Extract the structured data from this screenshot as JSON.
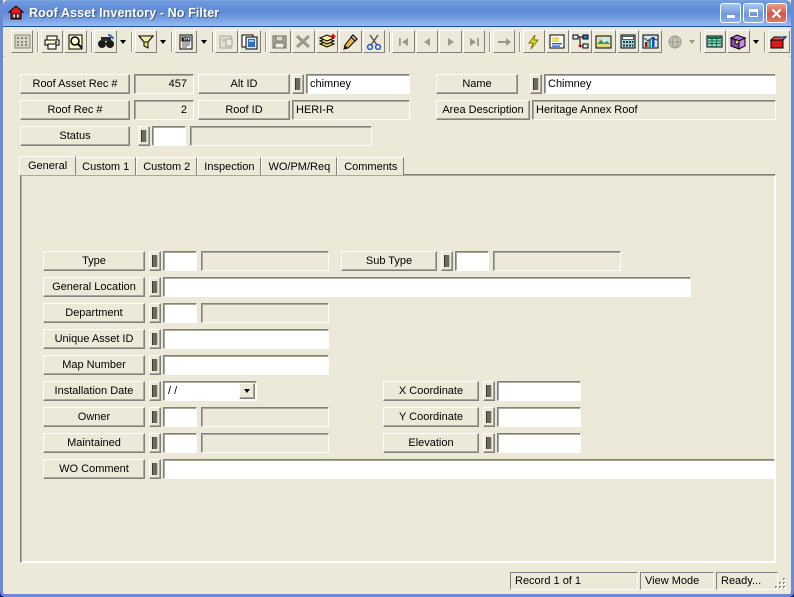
{
  "window": {
    "title": "Roof Asset Inventory - No Filter",
    "icon": "house-icon",
    "minimize_label": "Minimize",
    "maximize_label": "Maximize",
    "close_label": "Close",
    "accent_title_color": "#6d97dc",
    "face_color": "#ece9d8"
  },
  "toolbar": {
    "buttons": [
      {
        "name": "grid-view-icon",
        "label": "Grid View",
        "enabled": false
      },
      {
        "name": "print-icon",
        "label": "Print",
        "enabled": true
      },
      {
        "name": "print-preview-icon",
        "label": "Print Preview",
        "enabled": true
      },
      {
        "name": "find-icon",
        "label": "Find",
        "enabled": true
      },
      {
        "name": "filter-icon",
        "label": "Filter",
        "enabled": true
      },
      {
        "name": "report-icon",
        "label": "Report",
        "enabled": true
      },
      {
        "name": "copy-to-icon",
        "label": "Copy To",
        "enabled": false
      },
      {
        "name": "duplicate-record-icon",
        "label": "Duplicate Record",
        "enabled": true
      },
      {
        "name": "save-icon",
        "label": "Save",
        "enabled": false
      },
      {
        "name": "delete-record-icon",
        "label": "Delete Record",
        "enabled": false
      },
      {
        "name": "add-record-icon",
        "label": "Add Record",
        "enabled": true
      },
      {
        "name": "edit-record-icon",
        "label": "Edit Record",
        "enabled": true
      },
      {
        "name": "cut-icon",
        "label": "Cut",
        "enabled": true
      },
      {
        "name": "first-record-icon",
        "label": "First Record",
        "enabled": false
      },
      {
        "name": "previous-record-icon",
        "label": "Previous Record",
        "enabled": false
      },
      {
        "name": "next-record-icon",
        "label": "Next Record",
        "enabled": false
      },
      {
        "name": "last-record-icon",
        "label": "Last Record",
        "enabled": false
      },
      {
        "name": "goto-record-icon",
        "label": "Go To Record",
        "enabled": false
      },
      {
        "name": "action-icon",
        "label": "Action",
        "enabled": true
      },
      {
        "name": "notes-icon",
        "label": "Notes",
        "enabled": true
      },
      {
        "name": "links-icon",
        "label": "Links",
        "enabled": true
      },
      {
        "name": "image-icon",
        "label": "Image",
        "enabled": true
      },
      {
        "name": "calculator-icon",
        "label": "Calculator",
        "enabled": true
      },
      {
        "name": "chart-icon",
        "label": "Chart",
        "enabled": true
      },
      {
        "name": "globe-icon",
        "label": "Web",
        "enabled": false
      },
      {
        "name": "spreadsheet-icon",
        "label": "Spreadsheet",
        "enabled": true
      },
      {
        "name": "help-icon",
        "label": "Help",
        "enabled": true
      },
      {
        "name": "exit-icon",
        "label": "Exit",
        "enabled": true
      }
    ]
  },
  "header_fields": {
    "roof_asset_rec": {
      "label": "Roof Asset Rec #",
      "value": "457",
      "readonly": true
    },
    "alt_id": {
      "label": "Alt ID",
      "value": "chimney",
      "readonly": false
    },
    "name": {
      "label": "Name",
      "value": "Chimney",
      "readonly": false
    },
    "roof_rec": {
      "label": "Roof Rec #",
      "value": "2",
      "readonly": true
    },
    "roof_id": {
      "label": "Roof ID",
      "value": "HERI-R",
      "readonly": true
    },
    "area_description": {
      "label": "Area Description",
      "value": "Heritage Annex Roof",
      "readonly": true
    },
    "status": {
      "label": "Status",
      "code": "",
      "description": "",
      "readonly": false
    }
  },
  "tabs": [
    {
      "label": "General",
      "active": true
    },
    {
      "label": "Custom 1",
      "active": false
    },
    {
      "label": "Custom 2",
      "active": false
    },
    {
      "label": "Inspection",
      "active": false
    },
    {
      "label": "WO/PM/Req",
      "active": false
    },
    {
      "label": "Comments",
      "active": false
    }
  ],
  "general_tab": {
    "type": {
      "label": "Type",
      "code": "",
      "description": ""
    },
    "sub_type": {
      "label": "Sub Type",
      "code": "",
      "description": ""
    },
    "general_location": {
      "label": "General Location",
      "value": ""
    },
    "department": {
      "label": "Department",
      "code": "",
      "description": ""
    },
    "unique_asset_id": {
      "label": "Unique Asset ID",
      "value": ""
    },
    "map_number": {
      "label": "Map Number",
      "value": ""
    },
    "installation_date": {
      "label": "Installation Date",
      "value": "  /  /"
    },
    "owner": {
      "label": "Owner",
      "code": "",
      "description": ""
    },
    "maintained": {
      "label": "Maintained",
      "code": "",
      "description": ""
    },
    "wo_comment": {
      "label": "WO Comment",
      "value": ""
    },
    "x_coordinate": {
      "label": "X Coordinate",
      "value": ""
    },
    "y_coordinate": {
      "label": "Y Coordinate",
      "value": ""
    },
    "elevation": {
      "label": "Elevation",
      "value": ""
    }
  },
  "statusbar": {
    "record": "Record 1 of 1",
    "mode": "View Mode",
    "state": "Ready..."
  }
}
